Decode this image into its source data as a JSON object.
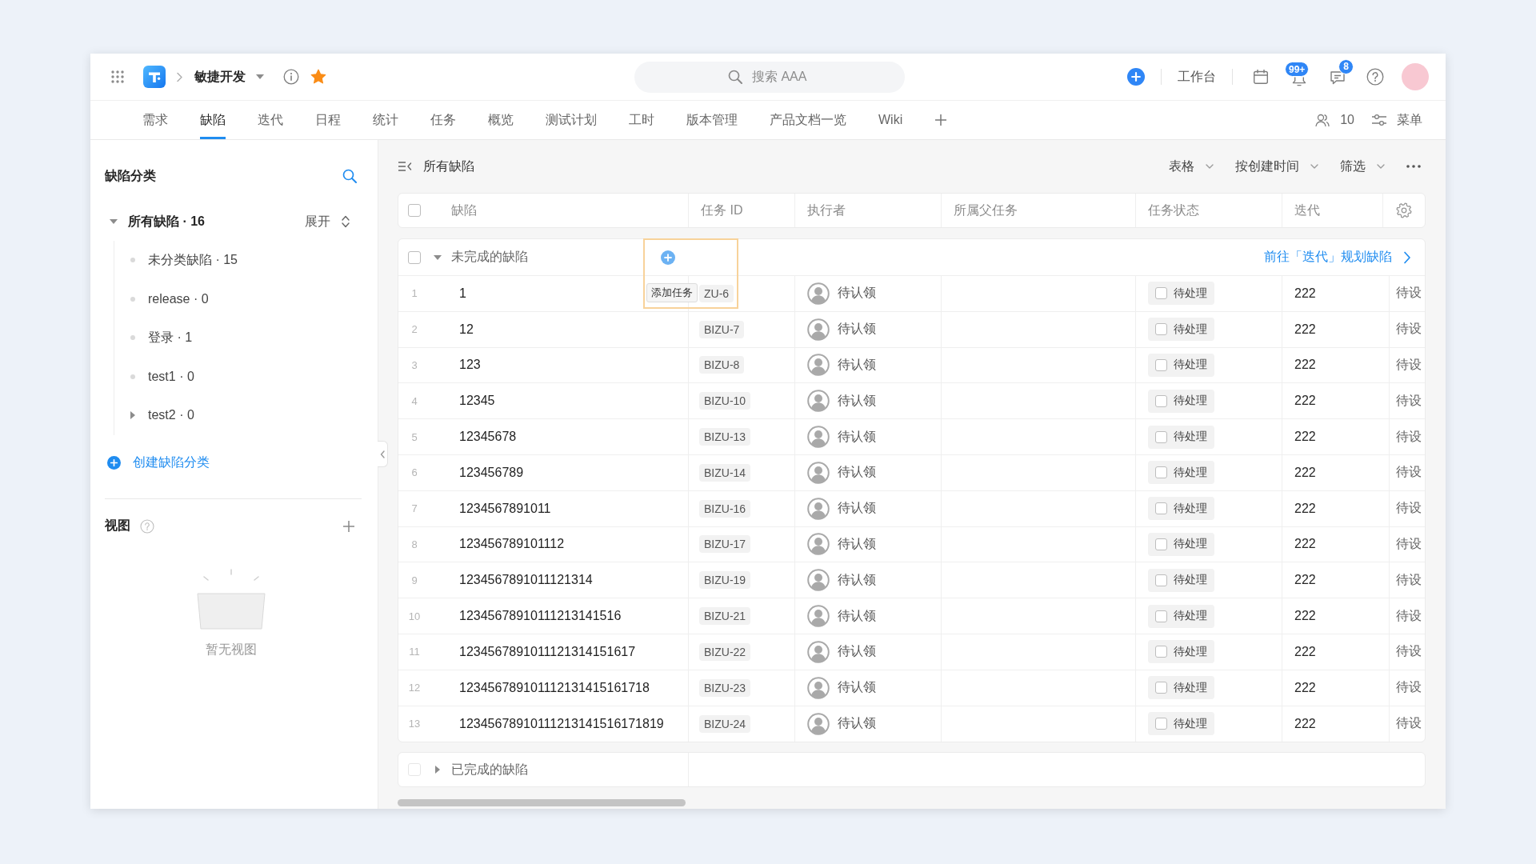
{
  "header": {
    "project": {
      "name": "敏捷开发",
      "starred": true
    },
    "search": {
      "placeholder": "搜索 AAA"
    },
    "workbench": "工作台",
    "notification_badge": "99+",
    "message_badge": "8"
  },
  "tabs": [
    {
      "label": "需求",
      "selected": false
    },
    {
      "label": "缺陷",
      "selected": true
    },
    {
      "label": "迭代",
      "selected": false
    },
    {
      "label": "日程",
      "selected": false
    },
    {
      "label": "统计",
      "selected": false
    },
    {
      "label": "任务",
      "selected": false
    },
    {
      "label": "概览",
      "selected": false
    },
    {
      "label": "测试计划",
      "selected": false
    },
    {
      "label": "工时",
      "selected": false
    },
    {
      "label": "版本管理",
      "selected": false
    },
    {
      "label": "产品文档一览",
      "selected": false
    },
    {
      "label": "Wiki",
      "selected": false
    }
  ],
  "tab_actions": {
    "members_count": "10",
    "menu": "菜单"
  },
  "sidebar": {
    "title": "缺陷分类",
    "tree": [
      {
        "label": "所有缺陷 · 16",
        "expanded": true,
        "action": "展开",
        "children": [
          {
            "label": "未分类缺陷 · 15",
            "kind": "leaf"
          },
          {
            "label": "release · 0",
            "kind": "leaf"
          },
          {
            "label": "登录 · 1",
            "kind": "leaf"
          },
          {
            "label": "test1 · 0",
            "kind": "leaf"
          },
          {
            "label": "test2 · 0",
            "kind": "branch",
            "expanded": false
          }
        ]
      }
    ],
    "create_button": "创建缺陷分类",
    "views": {
      "title": "视图",
      "empty_text": "暂无视图"
    }
  },
  "main": {
    "title": "所有缺陷",
    "toolbar": [
      "表格",
      "按创建时间",
      "筛选"
    ],
    "table": {
      "header_checked": false,
      "columns": [
        "缺陷",
        "任务 ID",
        "执行者",
        "所属父任务",
        "任务状态",
        "迭代"
      ],
      "groups": [
        {
          "label": "未完成的缺陷",
          "checked": false,
          "disabled": false,
          "expanded": true,
          "tooltip": "添加任务",
          "link": "前往「迭代」规划缺陷",
          "rows": [
            {
              "number": "1",
              "title": "1",
              "task_id": "ZU-6",
              "assignee": "待认领",
              "status": {
                "label": "待处理",
                "checked": false
              },
              "iteration": "222",
              "column_7": "待设"
            },
            {
              "number": "2",
              "title": "12",
              "task_id": "BIZU-7",
              "assignee": "待认领",
              "status": {
                "label": "待处理",
                "checked": false
              },
              "iteration": "222",
              "column_7": "待设"
            },
            {
              "number": "3",
              "title": "123",
              "task_id": "BIZU-8",
              "assignee": "待认领",
              "status": {
                "label": "待处理",
                "checked": false
              },
              "iteration": "222",
              "column_7": "待设"
            },
            {
              "number": "4",
              "title": "12345",
              "task_id": "BIZU-10",
              "assignee": "待认领",
              "status": {
                "label": "待处理",
                "checked": false
              },
              "iteration": "222",
              "column_7": "待设"
            },
            {
              "number": "5",
              "title": "12345678",
              "task_id": "BIZU-13",
              "assignee": "待认领",
              "status": {
                "label": "待处理",
                "checked": false
              },
              "iteration": "222",
              "column_7": "待设"
            },
            {
              "number": "6",
              "title": "123456789",
              "task_id": "BIZU-14",
              "assignee": "待认领",
              "status": {
                "label": "待处理",
                "checked": false
              },
              "iteration": "222",
              "column_7": "待设"
            },
            {
              "number": "7",
              "title": "1234567891011",
              "task_id": "BIZU-16",
              "assignee": "待认领",
              "status": {
                "label": "待处理",
                "checked": false
              },
              "iteration": "222",
              "column_7": "待设"
            },
            {
              "number": "8",
              "title": "123456789101112",
              "task_id": "BIZU-17",
              "assignee": "待认领",
              "status": {
                "label": "待处理",
                "checked": false
              },
              "iteration": "222",
              "column_7": "待设"
            },
            {
              "number": "9",
              "title": "1234567891011121314",
              "task_id": "BIZU-19",
              "assignee": "待认领",
              "status": {
                "label": "待处理",
                "checked": false
              },
              "iteration": "222",
              "column_7": "待设"
            },
            {
              "number": "10",
              "title": "12345678910111213141516",
              "task_id": "BIZU-21",
              "assignee": "待认领",
              "status": {
                "label": "待处理",
                "checked": false
              },
              "iteration": "222",
              "column_7": "待设"
            },
            {
              "number": "11",
              "title": "1234567891011121314151617",
              "task_id": "BIZU-22",
              "assignee": "待认领",
              "status": {
                "label": "待处理",
                "checked": false
              },
              "iteration": "222",
              "column_7": "待设"
            },
            {
              "number": "12",
              "title": "123456789101112131415161718",
              "task_id": "BIZU-23",
              "assignee": "待认领",
              "status": {
                "label": "待处理",
                "checked": false
              },
              "iteration": "222",
              "column_7": "待设"
            },
            {
              "number": "13",
              "title": "12345678910111213141516171819",
              "task_id": "BIZU-24",
              "assignee": "待认领",
              "status": {
                "label": "待处理",
                "checked": false
              },
              "iteration": "222",
              "column_7": "待设"
            }
          ]
        },
        {
          "label": "已完成的缺陷",
          "checked": false,
          "disabled": true,
          "expanded": false
        }
      ]
    }
  }
}
